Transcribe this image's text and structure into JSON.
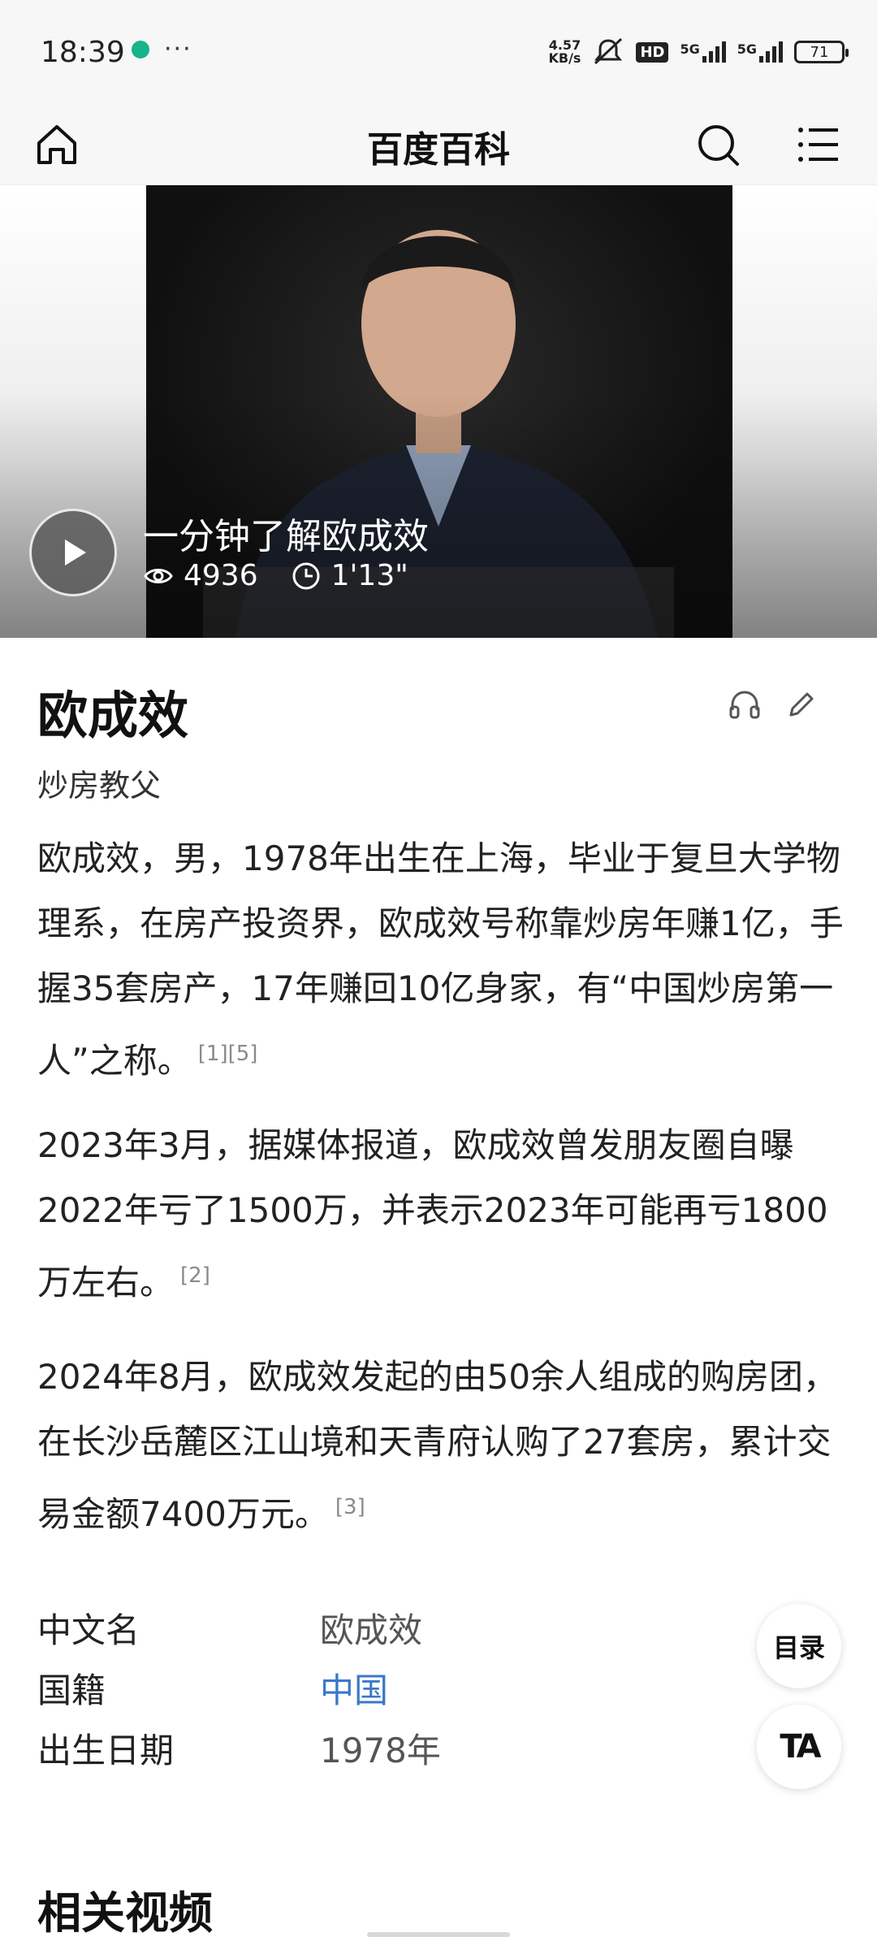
{
  "status_bar": {
    "time": "18:39",
    "more": "···",
    "speed_value": "4.57",
    "speed_unit": "KB/s",
    "hd": "HD",
    "sim1": "5G",
    "sim2": "5G",
    "battery": "71"
  },
  "header": {
    "title": "百度百科"
  },
  "video": {
    "title": "一分钟了解欧成效",
    "views": "4936",
    "duration": "1'13\""
  },
  "entry": {
    "title": "欧成效",
    "subtitle": "炒房教父",
    "paragraphs": [
      {
        "text": "欧成效，男，1978年出生在上海，毕业于复旦大学物理系，在房产投资界，欧成效号称靠炒房年赚1亿，手握35套房产，17年赚回10亿身家，有“中国炒房第一人”之称。",
        "ref": "[1][5]"
      },
      {
        "text": "2023年3月，据媒体报道，欧成效曾发朋友圈自曝2022年亏了1500万，并表示2023年可能再亏1800万左右。",
        "ref": "[2]"
      },
      {
        "text": "2024年8月，欧成效发起的由50余人组成的购房团，在长沙岳麓区江山境和天青府认购了27套房，累计交易金额7400万元。",
        "ref": "[3]"
      }
    ]
  },
  "info": {
    "rows": [
      {
        "label": "中文名",
        "value": "欧成效"
      },
      {
        "label": "国籍",
        "value": "中国"
      },
      {
        "label": "出生日期",
        "value": "1978年"
      }
    ]
  },
  "floating": {
    "toc": "目录",
    "ta": "TA"
  },
  "related": {
    "title": "相关视频"
  },
  "colors": {
    "link": "#3a78c9",
    "header_bg": "#f7f7f8"
  }
}
